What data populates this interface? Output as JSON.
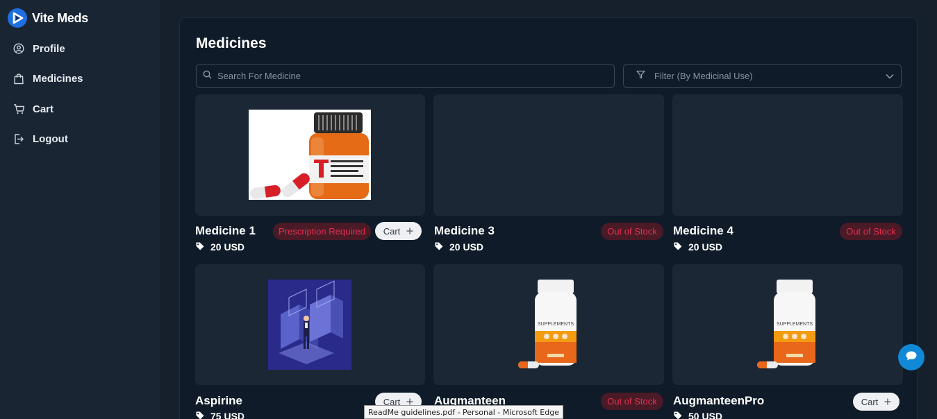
{
  "brand": {
    "name": "Vite Meds"
  },
  "sidebar": {
    "items": [
      {
        "label": "Profile",
        "icon": "user-circle-icon"
      },
      {
        "label": "Medicines",
        "icon": "shopping-bag-icon"
      },
      {
        "label": "Cart",
        "icon": "cart-icon"
      },
      {
        "label": "Logout",
        "icon": "logout-icon"
      }
    ]
  },
  "main": {
    "title": "Medicines",
    "search": {
      "placeholder": "Search For Medicine"
    },
    "filter": {
      "placeholder": "Filter (By Medicinal Use)"
    }
  },
  "cards": [
    {
      "name": "Medicine 1",
      "price": "20 USD",
      "badge": "Prescription Required",
      "cart": "Cart",
      "image": "pill-bottle"
    },
    {
      "name": "Medicine 3",
      "price": "20 USD",
      "badge": "Out of Stock",
      "cart": "",
      "image": "none"
    },
    {
      "name": "Medicine 4",
      "price": "20 USD",
      "badge": "Out of Stock",
      "cart": "",
      "image": "none"
    },
    {
      "name": "Aspirine",
      "price": "75 USD",
      "badge": "",
      "cart": "Cart",
      "image": "isometric-tech"
    },
    {
      "name": "Augmanteen",
      "price": "",
      "badge": "Out of Stock",
      "cart": "",
      "image": "supplement-bottle"
    },
    {
      "name": "AugmanteenPro",
      "price": "50 USD",
      "badge": "",
      "cart": "Cart",
      "image": "supplement-bottle"
    }
  ],
  "bottle_label": "SUPPLEMENTS",
  "tooltip": "ReadMe guidelines.pdf - Personal - Microsoft Edge",
  "colors": {
    "accent": "#1f6fe0",
    "badge_text": "#e2324f",
    "badge_bg": "#4b1a27",
    "chat": "#1189d6"
  }
}
